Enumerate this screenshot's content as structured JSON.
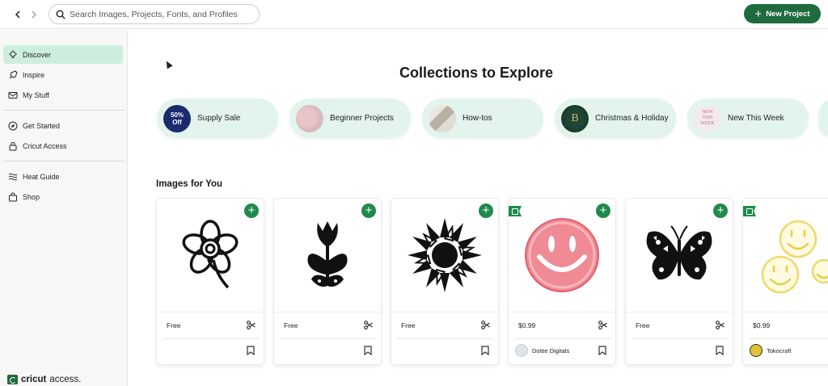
{
  "topbar": {
    "search_placeholder": "Search Images, Projects, Fonts, and Profiles",
    "new_project_label": "New Project",
    "back_icon": "chevron-left-icon",
    "forward_icon": "chevron-right-icon"
  },
  "sidebar": {
    "items": [
      {
        "label": "Discover",
        "icon": "lightbulb-icon",
        "active": true
      },
      {
        "label": "Inspire",
        "icon": "rocket-icon",
        "active": false
      },
      {
        "label": "My Stuff",
        "icon": "mail-icon",
        "active": false
      },
      {
        "label": "Get Started",
        "icon": "compass-icon",
        "active": false
      },
      {
        "label": "Cricut Access",
        "icon": "lock-icon",
        "active": false
      },
      {
        "label": "Heat Guide",
        "icon": "heat-waves-icon",
        "active": false
      },
      {
        "label": "Shop",
        "icon": "shopping-bag-icon",
        "active": false
      }
    ],
    "brand_name": "cricut",
    "brand_suffix": "access."
  },
  "collections": {
    "title": "Collections to Explore",
    "items": [
      {
        "label": "Supply Sale",
        "badge": "50% Off"
      },
      {
        "label": "Beginner Projects"
      },
      {
        "label": "How-tos"
      },
      {
        "label": "Christmas & Holiday",
        "badge": "B"
      },
      {
        "label": "New This Week",
        "badge": "NEW THIS WEEK"
      }
    ]
  },
  "images": {
    "title": "Images for You",
    "cards": [
      {
        "price": "Free",
        "design": "flower-outline",
        "access_flag": false,
        "author": ""
      },
      {
        "price": "Free",
        "design": "tulip-silhouette",
        "access_flag": false,
        "author": ""
      },
      {
        "price": "Free",
        "design": "sunflower",
        "access_flag": false,
        "author": ""
      },
      {
        "price": "$0.99",
        "design": "pink-smiley",
        "access_flag": true,
        "author": "Dottie Digitals"
      },
      {
        "price": "Free",
        "design": "butterfly",
        "access_flag": false,
        "author": ""
      },
      {
        "price": "$0.99",
        "design": "yellow-smileys",
        "access_flag": true,
        "author": "Tokocraft"
      }
    ]
  },
  "colors": {
    "brand_green": "#1f6b3e",
    "add_green": "#1f8a4c",
    "pill_bg": "#e2f4ec",
    "active_bg": "#cdeedd"
  }
}
